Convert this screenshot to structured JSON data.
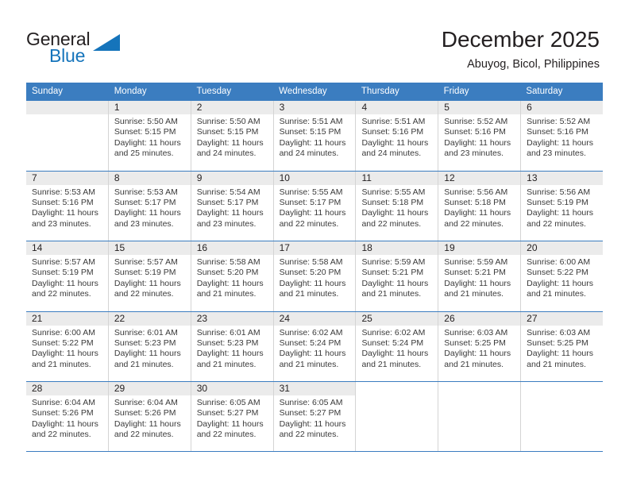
{
  "brand": {
    "name_part1": "General",
    "name_part2": "Blue",
    "accent_color": "#1574bb"
  },
  "header": {
    "title": "December 2025",
    "subtitle": "Abuyog, Bicol, Philippines"
  },
  "calendar": {
    "header_color": "#3b7dc0",
    "daynum_bg": "#ebebeb",
    "weekdays": [
      "Sunday",
      "Monday",
      "Tuesday",
      "Wednesday",
      "Thursday",
      "Friday",
      "Saturday"
    ],
    "weeks": [
      [
        {
          "day": "",
          "sunrise": "",
          "sunset": "",
          "daylight1": "",
          "daylight2": ""
        },
        {
          "day": "1",
          "sunrise": "Sunrise: 5:50 AM",
          "sunset": "Sunset: 5:15 PM",
          "daylight1": "Daylight: 11 hours",
          "daylight2": "and 25 minutes."
        },
        {
          "day": "2",
          "sunrise": "Sunrise: 5:50 AM",
          "sunset": "Sunset: 5:15 PM",
          "daylight1": "Daylight: 11 hours",
          "daylight2": "and 24 minutes."
        },
        {
          "day": "3",
          "sunrise": "Sunrise: 5:51 AM",
          "sunset": "Sunset: 5:15 PM",
          "daylight1": "Daylight: 11 hours",
          "daylight2": "and 24 minutes."
        },
        {
          "day": "4",
          "sunrise": "Sunrise: 5:51 AM",
          "sunset": "Sunset: 5:16 PM",
          "daylight1": "Daylight: 11 hours",
          "daylight2": "and 24 minutes."
        },
        {
          "day": "5",
          "sunrise": "Sunrise: 5:52 AM",
          "sunset": "Sunset: 5:16 PM",
          "daylight1": "Daylight: 11 hours",
          "daylight2": "and 23 minutes."
        },
        {
          "day": "6",
          "sunrise": "Sunrise: 5:52 AM",
          "sunset": "Sunset: 5:16 PM",
          "daylight1": "Daylight: 11 hours",
          "daylight2": "and 23 minutes."
        }
      ],
      [
        {
          "day": "7",
          "sunrise": "Sunrise: 5:53 AM",
          "sunset": "Sunset: 5:16 PM",
          "daylight1": "Daylight: 11 hours",
          "daylight2": "and 23 minutes."
        },
        {
          "day": "8",
          "sunrise": "Sunrise: 5:53 AM",
          "sunset": "Sunset: 5:17 PM",
          "daylight1": "Daylight: 11 hours",
          "daylight2": "and 23 minutes."
        },
        {
          "day": "9",
          "sunrise": "Sunrise: 5:54 AM",
          "sunset": "Sunset: 5:17 PM",
          "daylight1": "Daylight: 11 hours",
          "daylight2": "and 23 minutes."
        },
        {
          "day": "10",
          "sunrise": "Sunrise: 5:55 AM",
          "sunset": "Sunset: 5:17 PM",
          "daylight1": "Daylight: 11 hours",
          "daylight2": "and 22 minutes."
        },
        {
          "day": "11",
          "sunrise": "Sunrise: 5:55 AM",
          "sunset": "Sunset: 5:18 PM",
          "daylight1": "Daylight: 11 hours",
          "daylight2": "and 22 minutes."
        },
        {
          "day": "12",
          "sunrise": "Sunrise: 5:56 AM",
          "sunset": "Sunset: 5:18 PM",
          "daylight1": "Daylight: 11 hours",
          "daylight2": "and 22 minutes."
        },
        {
          "day": "13",
          "sunrise": "Sunrise: 5:56 AM",
          "sunset": "Sunset: 5:19 PM",
          "daylight1": "Daylight: 11 hours",
          "daylight2": "and 22 minutes."
        }
      ],
      [
        {
          "day": "14",
          "sunrise": "Sunrise: 5:57 AM",
          "sunset": "Sunset: 5:19 PM",
          "daylight1": "Daylight: 11 hours",
          "daylight2": "and 22 minutes."
        },
        {
          "day": "15",
          "sunrise": "Sunrise: 5:57 AM",
          "sunset": "Sunset: 5:19 PM",
          "daylight1": "Daylight: 11 hours",
          "daylight2": "and 22 minutes."
        },
        {
          "day": "16",
          "sunrise": "Sunrise: 5:58 AM",
          "sunset": "Sunset: 5:20 PM",
          "daylight1": "Daylight: 11 hours",
          "daylight2": "and 21 minutes."
        },
        {
          "day": "17",
          "sunrise": "Sunrise: 5:58 AM",
          "sunset": "Sunset: 5:20 PM",
          "daylight1": "Daylight: 11 hours",
          "daylight2": "and 21 minutes."
        },
        {
          "day": "18",
          "sunrise": "Sunrise: 5:59 AM",
          "sunset": "Sunset: 5:21 PM",
          "daylight1": "Daylight: 11 hours",
          "daylight2": "and 21 minutes."
        },
        {
          "day": "19",
          "sunrise": "Sunrise: 5:59 AM",
          "sunset": "Sunset: 5:21 PM",
          "daylight1": "Daylight: 11 hours",
          "daylight2": "and 21 minutes."
        },
        {
          "day": "20",
          "sunrise": "Sunrise: 6:00 AM",
          "sunset": "Sunset: 5:22 PM",
          "daylight1": "Daylight: 11 hours",
          "daylight2": "and 21 minutes."
        }
      ],
      [
        {
          "day": "21",
          "sunrise": "Sunrise: 6:00 AM",
          "sunset": "Sunset: 5:22 PM",
          "daylight1": "Daylight: 11 hours",
          "daylight2": "and 21 minutes."
        },
        {
          "day": "22",
          "sunrise": "Sunrise: 6:01 AM",
          "sunset": "Sunset: 5:23 PM",
          "daylight1": "Daylight: 11 hours",
          "daylight2": "and 21 minutes."
        },
        {
          "day": "23",
          "sunrise": "Sunrise: 6:01 AM",
          "sunset": "Sunset: 5:23 PM",
          "daylight1": "Daylight: 11 hours",
          "daylight2": "and 21 minutes."
        },
        {
          "day": "24",
          "sunrise": "Sunrise: 6:02 AM",
          "sunset": "Sunset: 5:24 PM",
          "daylight1": "Daylight: 11 hours",
          "daylight2": "and 21 minutes."
        },
        {
          "day": "25",
          "sunrise": "Sunrise: 6:02 AM",
          "sunset": "Sunset: 5:24 PM",
          "daylight1": "Daylight: 11 hours",
          "daylight2": "and 21 minutes."
        },
        {
          "day": "26",
          "sunrise": "Sunrise: 6:03 AM",
          "sunset": "Sunset: 5:25 PM",
          "daylight1": "Daylight: 11 hours",
          "daylight2": "and 21 minutes."
        },
        {
          "day": "27",
          "sunrise": "Sunrise: 6:03 AM",
          "sunset": "Sunset: 5:25 PM",
          "daylight1": "Daylight: 11 hours",
          "daylight2": "and 21 minutes."
        }
      ],
      [
        {
          "day": "28",
          "sunrise": "Sunrise: 6:04 AM",
          "sunset": "Sunset: 5:26 PM",
          "daylight1": "Daylight: 11 hours",
          "daylight2": "and 22 minutes."
        },
        {
          "day": "29",
          "sunrise": "Sunrise: 6:04 AM",
          "sunset": "Sunset: 5:26 PM",
          "daylight1": "Daylight: 11 hours",
          "daylight2": "and 22 minutes."
        },
        {
          "day": "30",
          "sunrise": "Sunrise: 6:05 AM",
          "sunset": "Sunset: 5:27 PM",
          "daylight1": "Daylight: 11 hours",
          "daylight2": "and 22 minutes."
        },
        {
          "day": "31",
          "sunrise": "Sunrise: 6:05 AM",
          "sunset": "Sunset: 5:27 PM",
          "daylight1": "Daylight: 11 hours",
          "daylight2": "and 22 minutes."
        },
        {
          "day": "",
          "sunrise": "",
          "sunset": "",
          "daylight1": "",
          "daylight2": ""
        },
        {
          "day": "",
          "sunrise": "",
          "sunset": "",
          "daylight1": "",
          "daylight2": ""
        },
        {
          "day": "",
          "sunrise": "",
          "sunset": "",
          "daylight1": "",
          "daylight2": ""
        }
      ]
    ]
  }
}
